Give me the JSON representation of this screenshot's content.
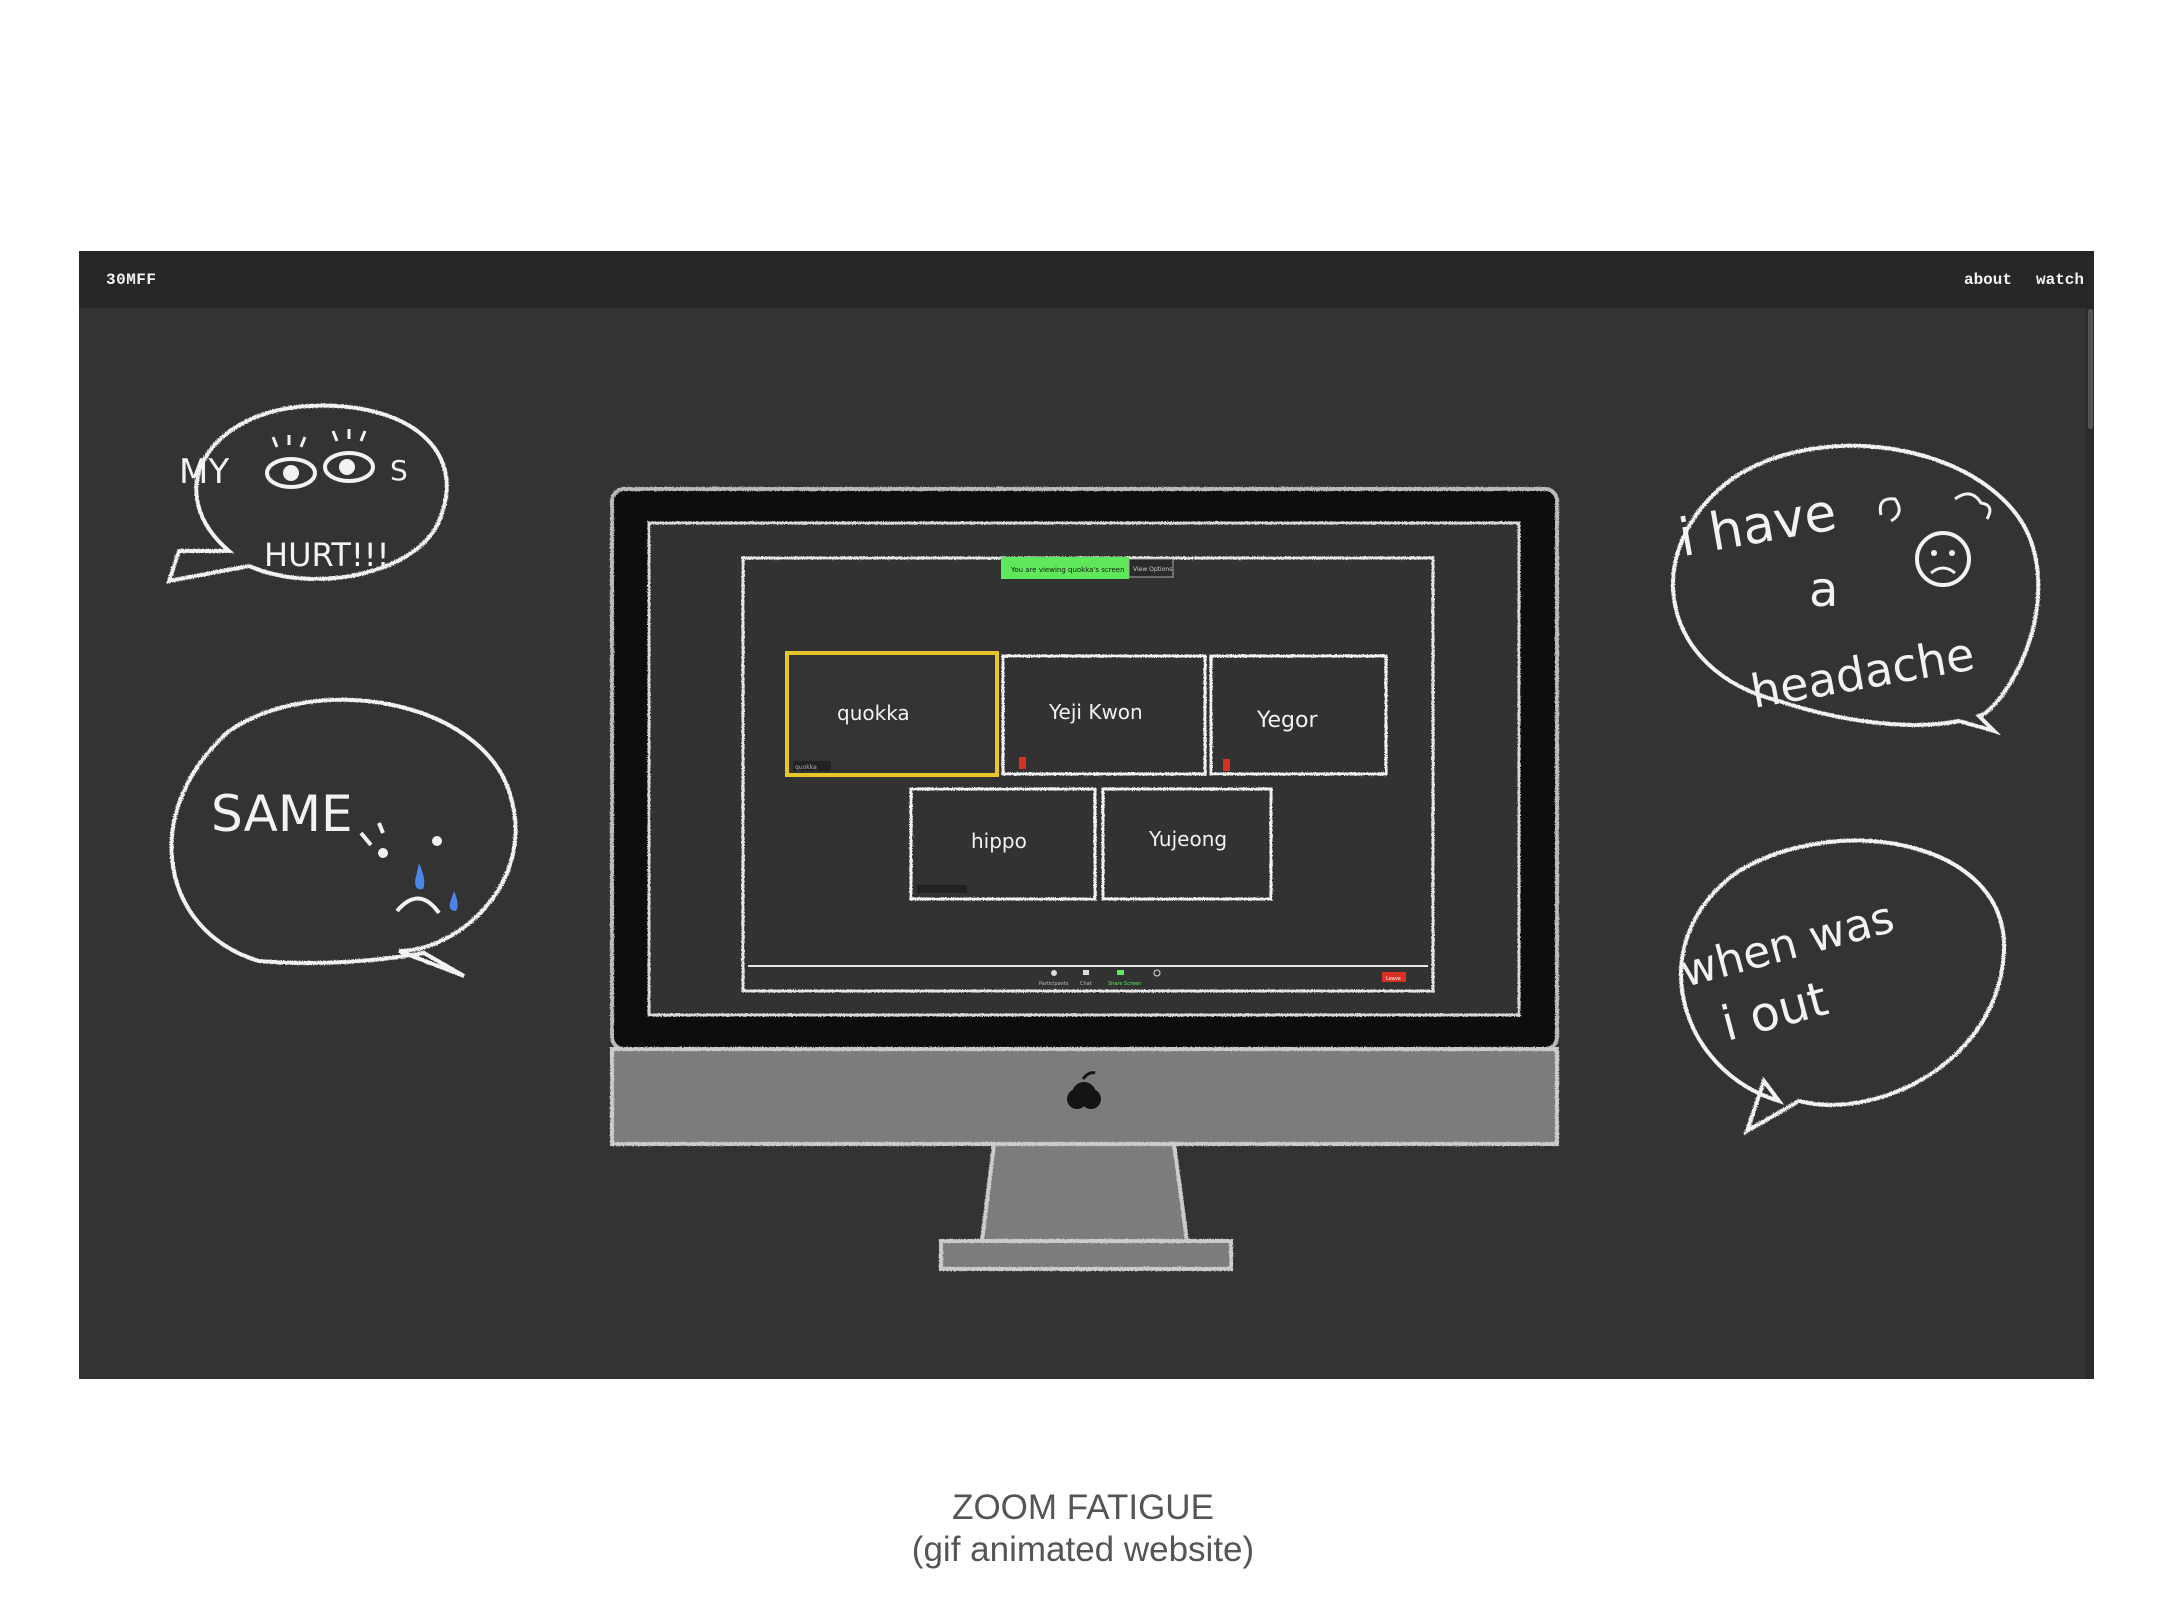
{
  "site": {
    "brand": "30MFF",
    "nav": [
      {
        "label": "about"
      },
      {
        "label": "watch"
      }
    ]
  },
  "artwork": {
    "bubbles": {
      "top_left": {
        "line1": "MY",
        "line1_suffix": "S",
        "line2": "HURT!!!"
      },
      "bottom_left": {
        "text": "SAME"
      },
      "top_right": {
        "line1": "i have",
        "line2": "a",
        "line3": "headache"
      },
      "bottom_right": {
        "line1": "when was",
        "line2": "i out"
      }
    },
    "meeting": {
      "banner": "You are viewing quokka's screen",
      "banner_button": "View Options",
      "participants": [
        {
          "name": "quokka",
          "active": true,
          "tag": "quokka"
        },
        {
          "name": "Yeji Kwon"
        },
        {
          "name": "Yegor"
        },
        {
          "name": "hippo"
        },
        {
          "name": "Yujeong"
        }
      ],
      "toolbar": [
        "Participants",
        "Chat",
        "Share Screen",
        "Leave"
      ]
    },
    "colors": {
      "background": "#333333",
      "nav": "#272727",
      "chalk": "#f2f2f2",
      "active_tile": "#e8c52a",
      "banner_green": "#5ee85a",
      "tear_blue": "#4a86e8",
      "leave_red": "#d93025"
    }
  },
  "caption": {
    "title": "ZOOM FATIGUE",
    "subtitle": "(gif animated website)"
  }
}
